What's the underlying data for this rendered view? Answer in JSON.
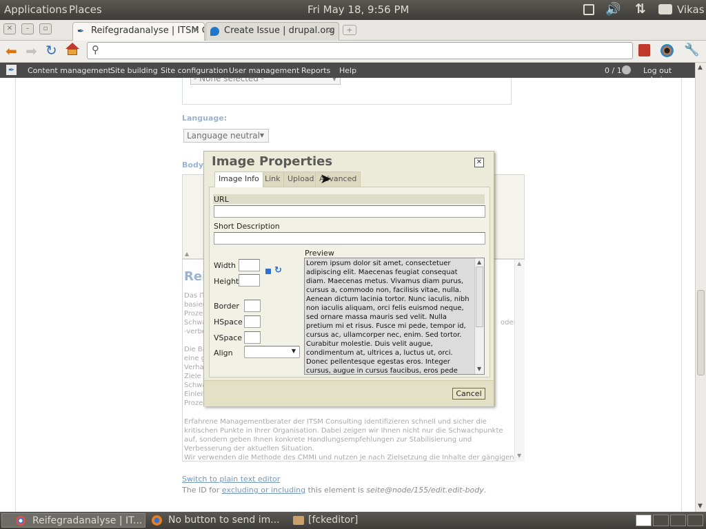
{
  "top_panel": {
    "applications": "Applications",
    "places": "Places",
    "clock": "Fri May 18,  9:56 PM",
    "user": "Vikas"
  },
  "browser": {
    "tabs": [
      {
        "title": "Reifegradanalyse | ITSM C..."
      },
      {
        "title": "Create Issue | drupal.org"
      }
    ],
    "address_value": ""
  },
  "admin_menu": {
    "items": [
      "Content management",
      "Site building",
      "Site configuration",
      "User management",
      "Reports",
      "Help"
    ],
    "users_count": "0 / 1",
    "logout": "Log out admin"
  },
  "page": {
    "select_none": "- None selected -",
    "language_label": "Language:",
    "language_value": "Language neutral",
    "body_label": "Body:",
    "editor_heading": "Reife",
    "para1_lines": [
      "Das IT",
      "basier",
      "Proze",
      "Schwa",
      "-verbe"
    ],
    "para1_right": [
      "oder"
    ],
    "para2_lines": [
      "Die Ba",
      "eine g",
      "Verha",
      "Ziele z",
      "Schwa",
      "Einleit",
      "Proze"
    ],
    "para3": "Erfahrene Managementberater der ITSM Consulting identifizieren schnell und sicher die kritischen Punkte in Ihrer Organisation. Dabei zeigen wir Ihnen nicht nur die Schwachpunkte auf, sondern geben Ihnen konkrete Handlungsempfehlungen zur Stabilisierung und Verbesserung der aktuellen Situation.",
    "para4": "Wir verwenden die Methode des CMMI und nutzen je nach Zielsetzung die Inhalte der gängigen",
    "switch_link": "Switch to plain text editor",
    "id_prefix": "The ID for ",
    "id_link": "excluding or including",
    "id_middle": " this element is ",
    "id_value": "seite@node/155/edit.edit-body",
    "id_suffix": "."
  },
  "dialog": {
    "title": "Image Properties",
    "tabs": [
      "Image Info",
      "Link",
      "Upload",
      "Advanced"
    ],
    "url_label": "URL",
    "url_value": "",
    "desc_label": "Short Description",
    "desc_value": "",
    "width_label": "Width",
    "height_label": "Height",
    "border_label": "Border",
    "hspace_label": "HSpace",
    "vspace_label": "VSpace",
    "align_label": "Align",
    "align_value": "",
    "preview_label": "Preview",
    "preview_text": "Lorem ipsum dolor sit amet, consectetuer adipiscing elit. Maecenas feugiat consequat diam. Maecenas metus. Vivamus diam purus, cursus a, commodo non, facilisis vitae, nulla. Aenean dictum lacinia tortor. Nunc iaculis, nibh non iaculis aliquam, orci felis euismod neque, sed ornare massa mauris sed velit. Nulla pretium mi et risus. Fusce mi pede, tempor id, cursus ac, ullamcorper nec, enim. Sed tortor. Curabitur molestie. Duis velit augue, condimentum at, ultrices a, luctus ut, orci. Donec pellentesque egestas eros. Integer cursus, augue in cursus faucibus, eros pede bibendum sem, in tempus tellus justo quis ligula.",
    "cancel": "Cancel"
  },
  "taskbar": {
    "items": [
      "Reifegradanalyse | IT...",
      "No button to send im...",
      "[fckeditor]"
    ]
  },
  "colors": {
    "accent": "#8aa6c8",
    "dialog_bg": "#ecebda",
    "panel": "#3d3c38"
  }
}
